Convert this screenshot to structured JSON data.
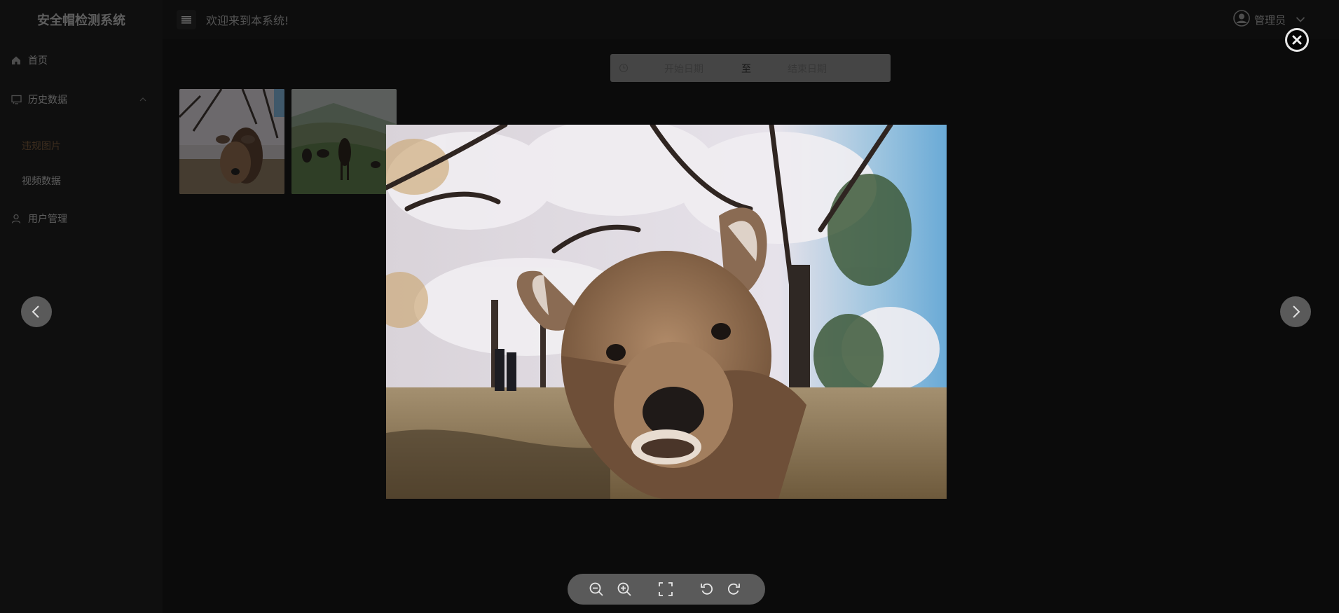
{
  "app": {
    "title": "安全帽检测系统"
  },
  "header": {
    "welcome": "欢迎来到本系统!",
    "user_name": "管理员"
  },
  "sidebar": {
    "items": [
      {
        "label": "首页",
        "icon": "home-icon"
      },
      {
        "label": "历史数据",
        "icon": "monitor-icon",
        "expanded": true,
        "children": [
          {
            "label": "违规图片",
            "active": true
          },
          {
            "label": "视频数据",
            "active": false
          }
        ]
      },
      {
        "label": "用户管理",
        "icon": "user-icon"
      }
    ]
  },
  "filter": {
    "start_placeholder": "开始日期",
    "separator": "至",
    "end_placeholder": "结束日期"
  },
  "thumbnails": [
    {
      "subject": "deer",
      "icon": "image-thumbnail-deer"
    },
    {
      "subject": "horses",
      "icon": "image-thumbnail-horses"
    }
  ],
  "viewer": {
    "open": true,
    "current_index": 0,
    "toolbar_icons": [
      "zoom-out-icon",
      "zoom-in-icon",
      "fullscreen-icon",
      "rotate-left-icon",
      "rotate-right-icon"
    ]
  },
  "colors": {
    "sidebar_bg": "#1f1f1f",
    "header_bg": "#1b1b1b",
    "active_menu": "#7a5a3c",
    "overlay": "rgba(0,0,0,0.5)"
  }
}
